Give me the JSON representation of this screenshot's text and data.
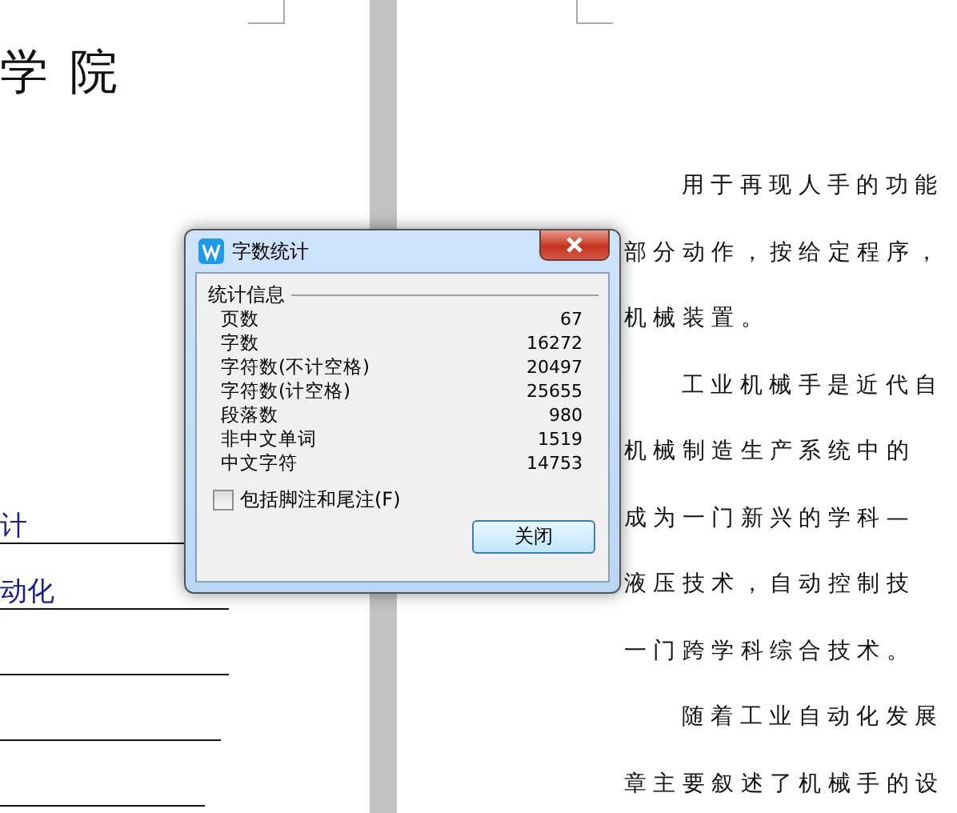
{
  "left_page": {
    "heading": "学 院",
    "fields": [
      {
        "value": "计"
      },
      {
        "value": "动化"
      }
    ]
  },
  "right_page": {
    "lines": [
      {
        "text": "用于再现人手的功能",
        "indent": true
      },
      {
        "text": "部分动作，按给定程序，",
        "indent": false
      },
      {
        "text": "机械装置。",
        "indent": false
      },
      {
        "text": "工业机械手是近代自",
        "indent": true
      },
      {
        "text": "机械制造生产系统中的",
        "indent": false
      },
      {
        "text": "成为一门新兴的学科—",
        "indent": false
      },
      {
        "text": "液压技术，自动控制技",
        "indent": false
      },
      {
        "text": "一门跨学科综合技术。",
        "indent": false
      },
      {
        "text": "随着工业自动化发展",
        "indent": true
      },
      {
        "text": "章主要叙述了机械手的设",
        "indent": false
      }
    ]
  },
  "dialog": {
    "title": "字数统计",
    "group": "统计信息",
    "stats": [
      {
        "label": "页数",
        "value": "67"
      },
      {
        "label": "字数",
        "value": "16272"
      },
      {
        "label": "字符数(不计空格)",
        "value": "20497"
      },
      {
        "label": "字符数(计空格)",
        "value": "25655"
      },
      {
        "label": "段落数",
        "value": "980"
      },
      {
        "label": "非中文单词",
        "value": "1519"
      },
      {
        "label": "中文字符",
        "value": "14753"
      }
    ],
    "checkbox": {
      "label": "包括脚注和尾注(F)",
      "checked": false
    },
    "button": "关闭"
  }
}
